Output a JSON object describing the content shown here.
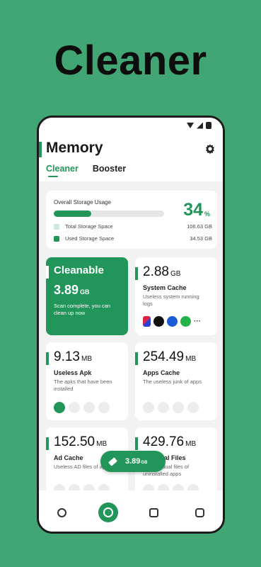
{
  "promo": {
    "title": "Cleaner"
  },
  "header": {
    "title": "Memory",
    "tabs": [
      {
        "label": "Cleaner",
        "active": true
      },
      {
        "label": "Booster",
        "active": false
      }
    ],
    "settings_icon": "gear-icon"
  },
  "storage": {
    "label": "Overall Storage Usage",
    "percent": "34",
    "percent_sign": "%",
    "usage_fraction": 0.34,
    "total_label": "Total Storage Space",
    "total_value": "106.63 GB",
    "used_label": "Used Storage Space",
    "used_value": "34.53 GB"
  },
  "cleanable": {
    "title": "Cleanable",
    "value": "3.89",
    "unit": "GB",
    "desc": "Scan complete, you can clean up now"
  },
  "cards": [
    {
      "value": "2.88",
      "unit": "GB",
      "title": "System Cache",
      "desc": "Useless system running logs"
    },
    {
      "value": "9.13",
      "unit": "MB",
      "title": "Useless Apk",
      "desc": "The apks that have been installed"
    },
    {
      "value": "254.49",
      "unit": "MB",
      "title": "Apps Cache",
      "desc": "The useless junk of apps"
    },
    {
      "value": "152.50",
      "unit": "MB",
      "title": "Ad Cache",
      "desc": "Useless AD files of apps"
    },
    {
      "value": "429.76",
      "unit": "MB",
      "title": "Residual Files",
      "desc": "The residual files of uninstalled apps"
    }
  ],
  "fab": {
    "value": "3.89",
    "unit": "GB",
    "icon": "broom-icon"
  },
  "nav": [
    "gear-icon",
    "cleaner-icon",
    "storage-icon",
    "chat-icon"
  ],
  "colors": {
    "accent": "#21955a",
    "background": "#41a673"
  }
}
